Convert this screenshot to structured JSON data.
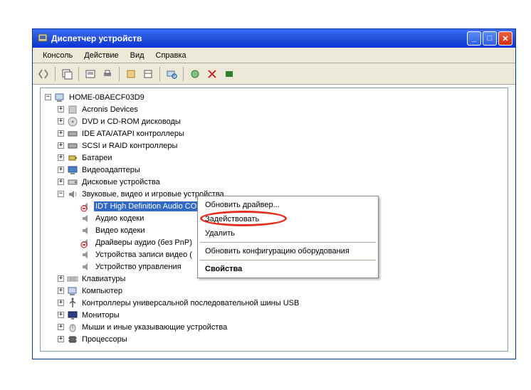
{
  "title": "Диспетчер устройств",
  "menu": {
    "console": "Консоль",
    "action": "Действие",
    "view": "Вид",
    "help": "Справка"
  },
  "root": "HOME-0BAECF03D9",
  "categories": [
    {
      "label": "Acronis Devices",
      "icon": "device"
    },
    {
      "label": "DVD и CD-ROM дисководы",
      "icon": "cd"
    },
    {
      "label": "IDE ATA/ATAPI контроллеры",
      "icon": "ide"
    },
    {
      "label": "SCSI и RAID контроллеры",
      "icon": "scsi"
    },
    {
      "label": "Батареи",
      "icon": "battery"
    },
    {
      "label": "Видеоадаптеры",
      "icon": "display"
    },
    {
      "label": "Дисковые устройства",
      "icon": "disk"
    }
  ],
  "sound_category": "Звуковые, видео и игровые устройства",
  "sound_children": [
    {
      "label": "IDT High Definition Audio CODEC",
      "selected": true,
      "disabled": true
    },
    {
      "label": "Аудио кодеки"
    },
    {
      "label": "Видео кодеки"
    },
    {
      "label": "Драйверы аудио (без PnP)",
      "disabled": true
    },
    {
      "label": "Устройства записи видео ("
    },
    {
      "label": "Устройство управления"
    }
  ],
  "after_cats": [
    {
      "label": "Клавиатуры",
      "icon": "keyboard"
    },
    {
      "label": "Компьютер",
      "icon": "computer"
    },
    {
      "label": "Контроллеры универсальной последовательной шины USB",
      "icon": "usb"
    },
    {
      "label": "Мониторы",
      "icon": "monitor"
    },
    {
      "label": "Мыши и иные указывающие устройства",
      "icon": "mouse"
    },
    {
      "label": "Процессоры",
      "icon": "cpu"
    }
  ],
  "context_menu": {
    "update": "Обновить драйвер...",
    "enable": "Задействовать",
    "delete": "Удалить",
    "rescan": "Обновить конфигурацию оборудования",
    "properties": "Свойства"
  },
  "glyphs": {
    "minus": "−",
    "plus": "+",
    "minimize": "_",
    "maximize": "□",
    "close": "✕"
  }
}
